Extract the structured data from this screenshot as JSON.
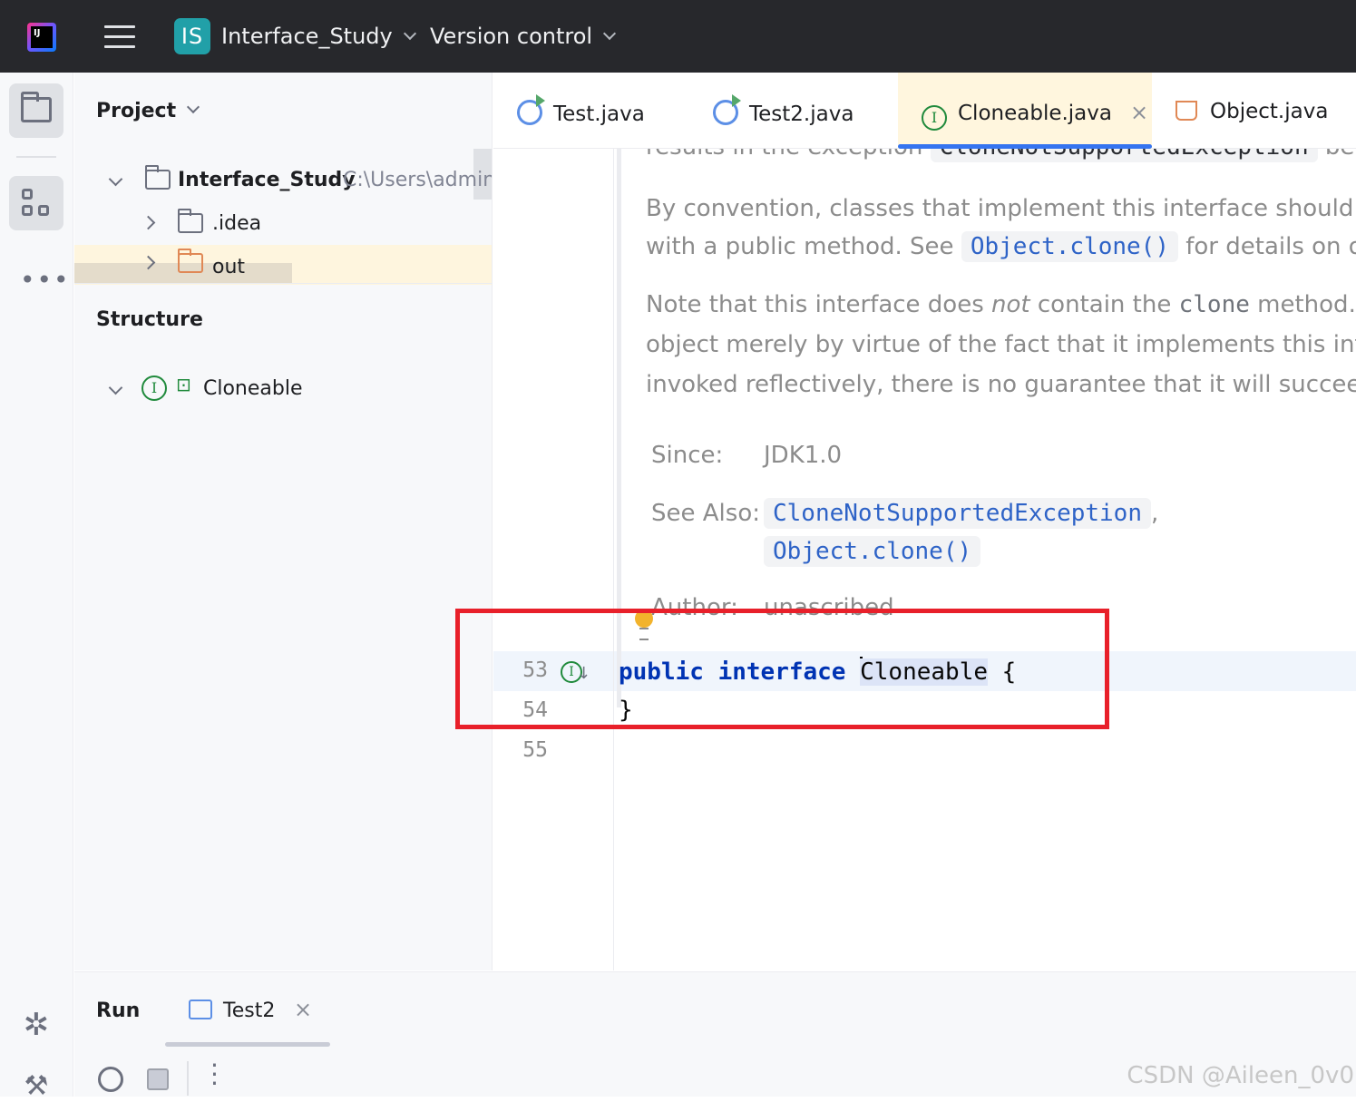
{
  "topbar": {
    "project_badge": "IS",
    "project_name": "Interface_Study",
    "vcs_label": "Version control",
    "logo_text": "IJ"
  },
  "project_panel": {
    "title": "Project",
    "root_name": "Interface_Study",
    "root_path": "C:\\Users\\admin\\",
    "items": [
      ".idea",
      "out"
    ]
  },
  "structure_panel": {
    "title": "Structure",
    "item": "Cloneable"
  },
  "tabs": [
    {
      "label": "Test.java"
    },
    {
      "label": "Test2.java"
    },
    {
      "label": "Cloneable.java",
      "close": "×"
    },
    {
      "label": "Object.java"
    }
  ],
  "doc": {
    "line1_pre": "results in the exception",
    "line1_code": "CloneNotSupportedException",
    "line1_post": "being t",
    "line2": "By convention, classes that implement this interface should ove",
    "line3_pre": "with a public method. See",
    "line3_link": "Object.clone()",
    "line3_post": "for details on ove",
    "line4_pre": "Note that this interface does",
    "line4_em": "not",
    "line4_mid": "contain the",
    "line4_code": "clone",
    "line4_post": "method. Th",
    "line5": "object merely by virtue of the fact that it implements this inter",
    "line6": "invoked reflectively, there is no guarantee that it will succeed.",
    "since_label": "Since:",
    "since_value": "JDK1.0",
    "see_label": "See Also:",
    "see_link1": "CloneNotSupportedException",
    "see_sep": ",",
    "see_link2": "Object.clone()",
    "author_label": "Author:",
    "author_value": "unascribed"
  },
  "code": {
    "lines": [
      {
        "num": "53",
        "kw1": "public",
        "kw2": "interface",
        "name": "Cloneable",
        "rest": " {"
      },
      {
        "num": "54",
        "text": "}"
      },
      {
        "num": "55",
        "text": ""
      }
    ]
  },
  "run_panel": {
    "title": "Run",
    "tab_label": "Test2",
    "tab_close": "×"
  },
  "watermark": "CSDN @Aileen_0v0",
  "colors": {
    "accent": "#3574f0",
    "annotation_box": "#e8202a",
    "keyword": "#0033b3",
    "interface_icon": "#208a3c"
  }
}
